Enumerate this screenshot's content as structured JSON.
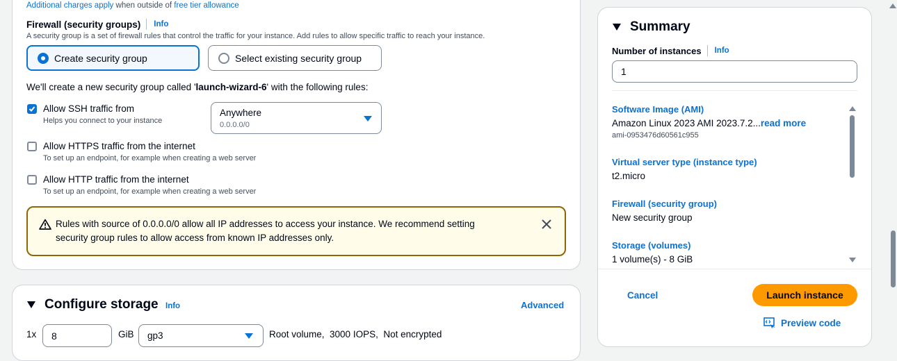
{
  "top": {
    "additional_charges": "Additional charges apply",
    "when_outside": "when outside of",
    "free_tier": "free tier allowance"
  },
  "firewall": {
    "title": "Firewall (security groups)",
    "info": "Info",
    "description": "A security group is a set of firewall rules that control the traffic for your instance. Add rules to allow specific traffic to reach your instance.",
    "option_create": "Create security group",
    "option_select": "Select existing security group",
    "creating_prefix": "We'll create a new security group called '",
    "group_name": "launch-wizard-6",
    "creating_suffix": "' with the following rules:",
    "ssh_label": "Allow SSH traffic from",
    "ssh_help": "Helps you connect to your instance",
    "ssh_source_label": "Anywhere",
    "ssh_source_value": "0.0.0.0/0",
    "https_label": "Allow HTTPS traffic from the internet",
    "https_help": "To set up an endpoint, for example when creating a web server",
    "http_label": "Allow HTTP traffic from the internet",
    "http_help": "To set up an endpoint, for example when creating a web server",
    "warning_line1": "Rules with source of 0.0.0.0/0 allow all IP addresses to access your instance. We recommend setting",
    "warning_line2": "security group rules to allow access from known IP addresses only."
  },
  "storage": {
    "title": "Configure storage",
    "info": "Info",
    "advanced": "Advanced",
    "multiplier": "1x",
    "size": "8",
    "unit": "GiB",
    "volume_type": "gp3",
    "details": "Root volume,  3000 IOPS,  Not encrypted"
  },
  "summary": {
    "title": "Summary",
    "instances_label": "Number of instances",
    "info": "Info",
    "instances_value": "1",
    "ami_label": "Software Image (AMI)",
    "ami_value": "Amazon Linux 2023 AMI 2023.7.2...",
    "read_more": "read more",
    "ami_id": "ami-0953476d60561c955",
    "instance_type_label": "Virtual server type (instance type)",
    "instance_type_value": "t2.micro",
    "firewall_label": "Firewall (security group)",
    "firewall_value": "New security group",
    "storage_label": "Storage (volumes)",
    "storage_value": "1 volume(s) - 8 GiB",
    "cancel": "Cancel",
    "launch": "Launch instance",
    "preview_code": "Preview code"
  },
  "colors": {
    "accent": "#0972d3",
    "primary_button": "#ff9900",
    "warning_border": "#8d6605",
    "warning_bg": "#fffce9"
  }
}
